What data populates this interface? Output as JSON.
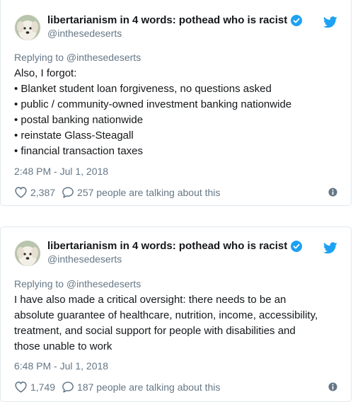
{
  "colors": {
    "twitter_blue": "#1da1f2",
    "text": "#14171a",
    "muted": "#657786",
    "border": "#e1e8ed"
  },
  "tweets": [
    {
      "display_name": "libertarianism in 4 words: pothead who is racist",
      "handle": "@inthesedeserts",
      "replying_to": "Replying to @inthesedeserts",
      "lines": [
        "Also, I forgot:",
        "• Blanket student loan forgiveness, no questions asked",
        "• public / community-owned investment banking nationwide",
        "• postal banking nationwide",
        "• reinstate Glass-Steagall",
        "• financial transaction taxes"
      ],
      "timestamp": "2:48 PM - Jul 1, 2018",
      "likes": "2,387",
      "talking": "257 people are talking about this"
    },
    {
      "display_name": "libertarianism in 4 words: pothead who is racist",
      "handle": "@inthesedeserts",
      "replying_to": "Replying to @inthesedeserts",
      "lines": [
        "I have also made a critical oversight: there needs to be an",
        "absolute guarantee of healthcare, nutrition, income, accessibility,",
        "treatment, and social support for people with disabilities and",
        "those unable to work"
      ],
      "timestamp": "6:48 PM - Jul 1, 2018",
      "likes": "1,749",
      "talking": "187 people are talking about this"
    }
  ],
  "icons": {
    "avatar": "avatar-dog",
    "verified": "verified-badge-icon",
    "brand": "twitter-bird-icon",
    "like": "heart-icon",
    "reply": "speech-bubble-icon",
    "info": "info-icon"
  }
}
